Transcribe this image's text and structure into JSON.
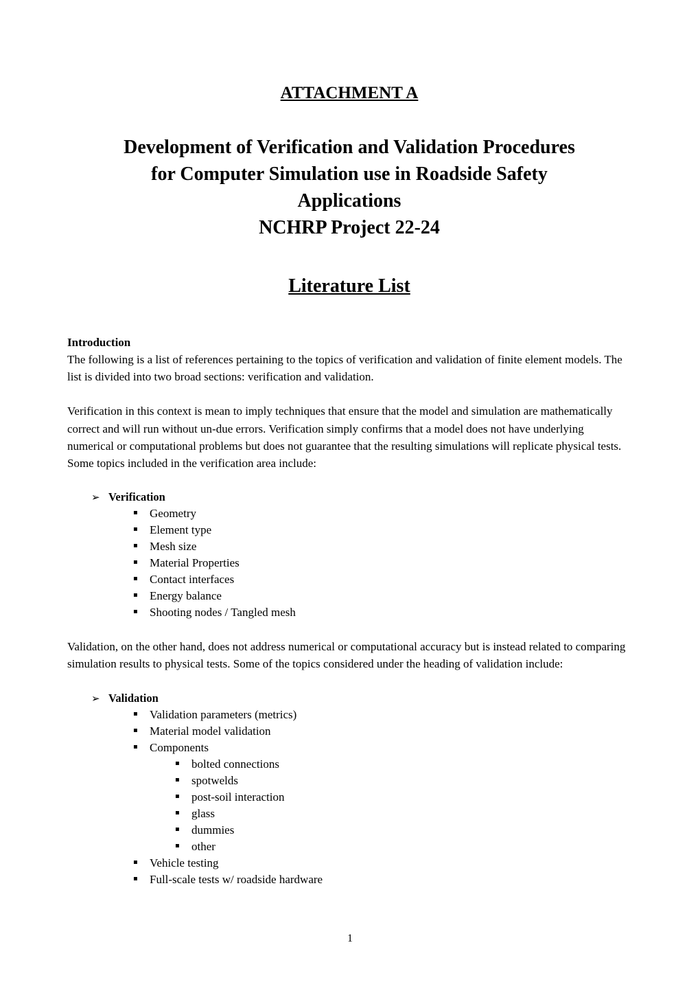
{
  "document": {
    "attachment_heading": "ATTACHMENT A",
    "title_lines": [
      "Development of Verification and Validation Procedures",
      "for Computer Simulation use in Roadside Safety",
      "Applications",
      "NCHRP Project 22-24"
    ],
    "literature_heading": "Literature List",
    "page_number": "1"
  },
  "introduction": {
    "heading": "Introduction",
    "paragraph_1": "The following is a list of references pertaining to the topics of verification and validation of finite element models.  The list is divided into two broad sections: verification and validation.",
    "paragraph_2": "Verification in this context is mean to imply techniques that ensure that the model and simulation are mathematically correct and will run without un-due errors. Verification simply confirms that a model does not have underlying numerical or computational problems but does not guarantee that the resulting simulations will replicate physical tests. Some topics included in the verification area include:",
    "paragraph_3": "Validation, on the other hand, does not address numerical or computational accuracy but is instead related to comparing simulation results to physical tests.  Some of the topics considered under the heading of validation include:"
  },
  "bullets": {
    "level1_glyph": "➢",
    "level2_glyph": "▪",
    "level3_glyph": "▪"
  },
  "verification_list": {
    "label": "Verification",
    "items": [
      "Geometry",
      "Element type",
      "Mesh size",
      "Material Properties",
      "Contact interfaces",
      "Energy balance",
      "Shooting nodes / Tangled mesh"
    ]
  },
  "validation_list": {
    "label": "Validation",
    "items_before": [
      "Validation parameters (metrics)",
      "Material model validation",
      "Components"
    ],
    "components_subitems": [
      "bolted connections",
      "spotwelds",
      "post-soil interaction",
      "glass",
      "dummies",
      "other"
    ],
    "items_after": [
      "Vehicle testing",
      "Full-scale tests w/ roadside hardware"
    ]
  }
}
